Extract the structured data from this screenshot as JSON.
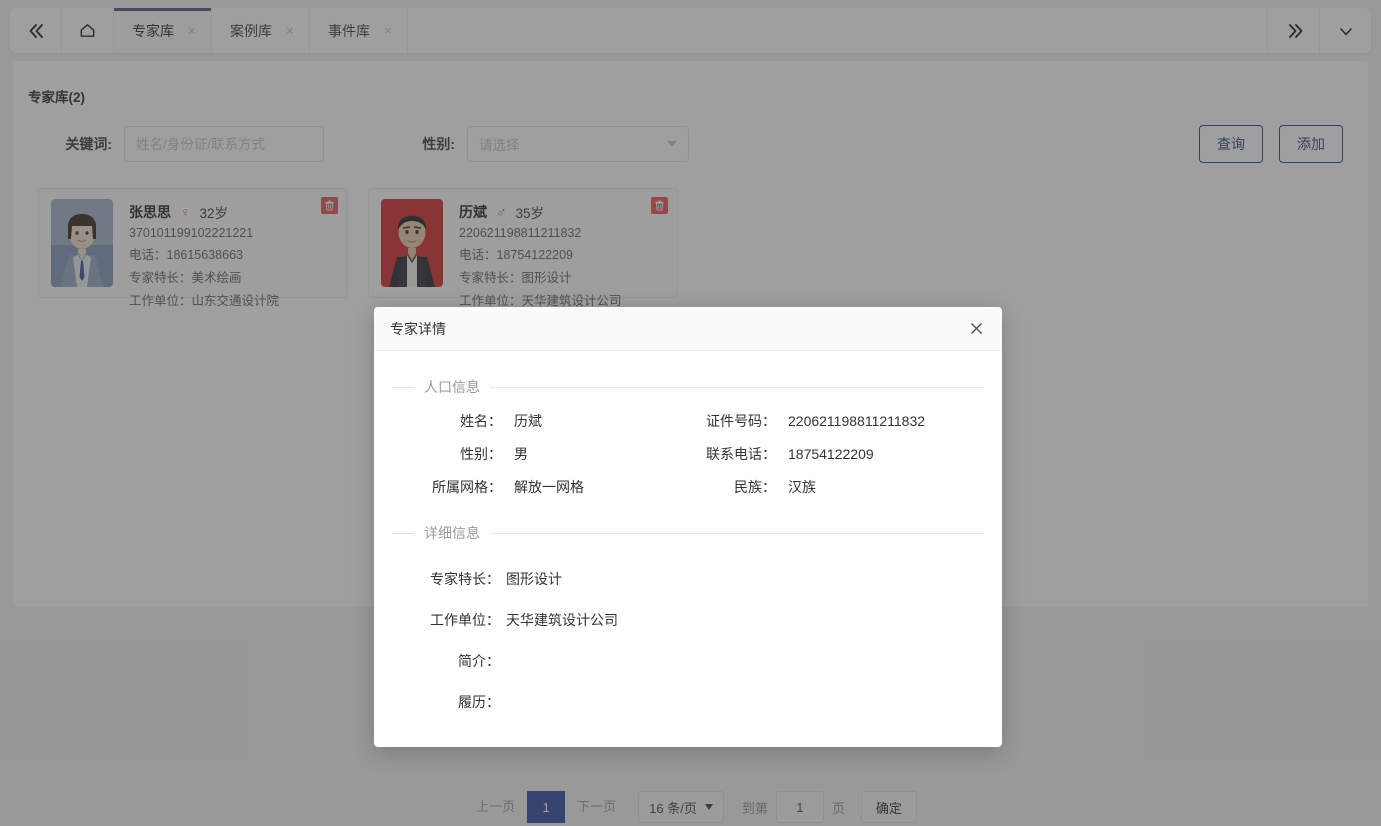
{
  "tabbar": {
    "collapse_icon": "double-chevron-left-icon",
    "home_icon": "home-icon",
    "expand_icon": "double-chevron-right-icon",
    "more_icon": "chevron-down-icon",
    "tabs": [
      {
        "label": "专家库",
        "active": true,
        "close": "×"
      },
      {
        "label": "案例库",
        "active": false,
        "close": "×"
      },
      {
        "label": "事件库",
        "active": false,
        "close": "×"
      }
    ]
  },
  "panel": {
    "title": "专家库(2)"
  },
  "filters": {
    "keyword_label": "关键词:",
    "keyword_value": "",
    "keyword_placeholder": "姓名/身份证/联系方式",
    "gender_label": "性别:",
    "gender_value": "请选择",
    "search_label": "查询",
    "add_label": "添加"
  },
  "cards": [
    {
      "name": "张思思",
      "gender_symbol": "♀",
      "gender_class": "f",
      "age": "32岁",
      "id_number": "370101199102221221",
      "phone": "电话：18615638663",
      "specialty": "专家特长：美术绘画",
      "workplace": "工作单位：山东交通设计院",
      "delete_icon": "trash-icon"
    },
    {
      "name": "历斌",
      "gender_symbol": "♂",
      "gender_class": "m",
      "age": "35岁",
      "id_number": "220621198811211832",
      "phone": "电话：18754122209",
      "specialty": "专家特长：图形设计",
      "workplace": "工作单位：天华建筑设计公司",
      "delete_icon": "trash-icon"
    }
  ],
  "modal": {
    "title": "专家详情",
    "close_icon": "close-icon",
    "section_population": "人口信息",
    "section_detail": "详细信息",
    "fields": {
      "name_label": "姓名：",
      "name_value": "历斌",
      "idcard_label": "证件号码：",
      "idcard_value": "220621198811211832",
      "gender_label": "性别：",
      "gender_value": "男",
      "phone_label": "联系电话：",
      "phone_value": "18754122209",
      "grid_label": "所属网格：",
      "grid_value": "解放一网格",
      "ethnic_label": "民族：",
      "ethnic_value": "汉族"
    },
    "details": [
      {
        "label": "专家特长：",
        "value": "图形设计"
      },
      {
        "label": "工作单位：",
        "value": "天华建筑设计公司"
      },
      {
        "label": "简介：",
        "value": ""
      },
      {
        "label": "履历：",
        "value": ""
      }
    ]
  },
  "pager": {
    "prev_label": "上一页",
    "current_page": "1",
    "next_label": "下一页",
    "page_size": "16 条/页",
    "goto_label": "到第",
    "goto_value": "1",
    "page_unit": "页",
    "confirm_label": "确定"
  },
  "colors": {
    "active_tab_border": "#484b7f",
    "primary_button_border": "#1e3a8a",
    "pager_active_bg": "#2a3f9e",
    "delete_badge": "#e24b4b",
    "female_symbol": "#e06a8a",
    "male_symbol": "#3f86e0"
  }
}
